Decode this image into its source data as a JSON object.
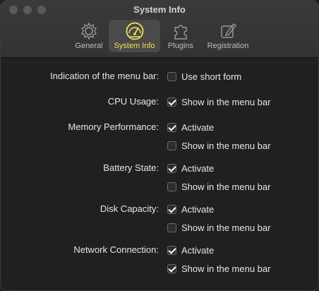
{
  "window": {
    "title": "System Info"
  },
  "tabs": [
    {
      "label": "General",
      "icon": "gear-icon"
    },
    {
      "label": "System Info",
      "icon": "speedometer-icon"
    },
    {
      "label": "Plugins",
      "icon": "puzzle-icon"
    },
    {
      "label": "Registration",
      "icon": "pen-icon"
    }
  ],
  "colors": {
    "accent": "#f2e34a",
    "background": "#202020"
  },
  "settings": [
    {
      "label": "Indication of the menu bar:",
      "options": [
        {
          "text": "Use short form",
          "checked": false
        }
      ]
    },
    {
      "label": "CPU Usage:",
      "options": [
        {
          "text": "Show in the menu bar",
          "checked": true
        }
      ]
    },
    {
      "label": "Memory Performance:",
      "options": [
        {
          "text": "Activate",
          "checked": true
        },
        {
          "text": "Show in the menu bar",
          "checked": false
        }
      ]
    },
    {
      "label": "Battery State:",
      "options": [
        {
          "text": "Activate",
          "checked": true
        },
        {
          "text": "Show in the menu bar",
          "checked": false
        }
      ]
    },
    {
      "label": "Disk Capacity:",
      "options": [
        {
          "text": "Activate",
          "checked": true
        },
        {
          "text": "Show in the menu bar",
          "checked": false
        }
      ]
    },
    {
      "label": "Network Connection:",
      "options": [
        {
          "text": "Activate",
          "checked": true
        },
        {
          "text": "Show in the menu bar",
          "checked": true
        }
      ]
    }
  ]
}
